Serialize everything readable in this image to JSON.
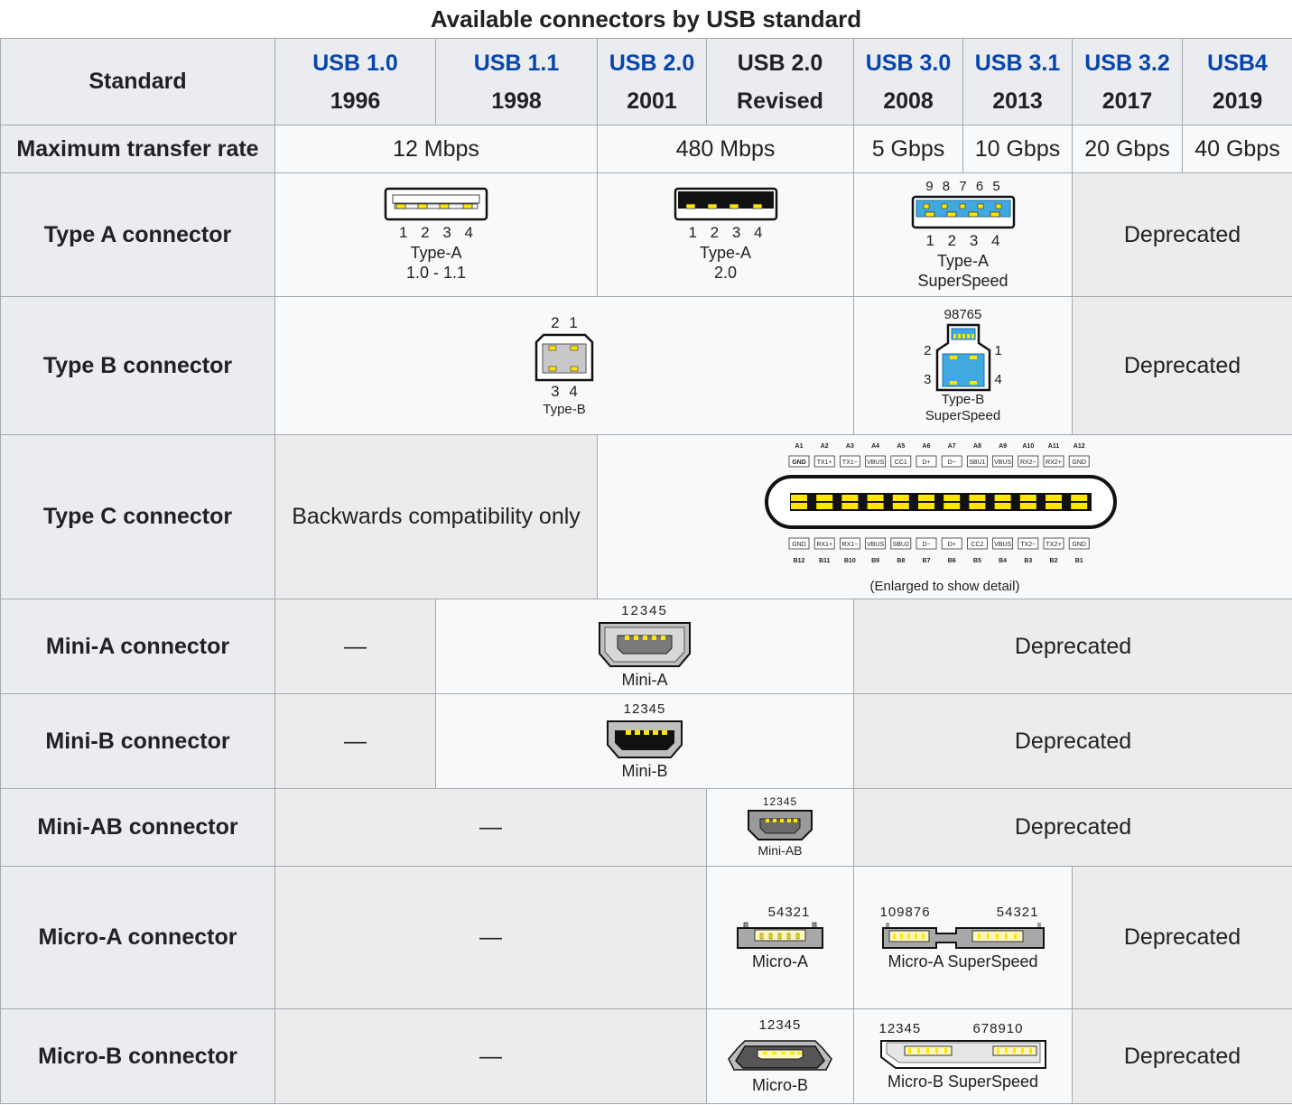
{
  "caption": "Available connectors by USB standard",
  "header": {
    "standard_label": "Standard",
    "columns": [
      {
        "name": "USB 1.0",
        "year": "1996",
        "link": true
      },
      {
        "name": "USB 1.1",
        "year": "1998",
        "link": true
      },
      {
        "name": "USB 2.0",
        "year": "2001",
        "link": true
      },
      {
        "name": "USB 2.0",
        "year": "Revised",
        "link": false
      },
      {
        "name": "USB 3.0",
        "year": "2008",
        "link": true
      },
      {
        "name": "USB 3.1",
        "year": "2013",
        "link": true
      },
      {
        "name": "USB 3.2",
        "year": "2017",
        "link": true
      },
      {
        "name": "USB4",
        "year": "2019",
        "link": true
      }
    ]
  },
  "rows": {
    "rate": {
      "label": "Maximum transfer rate",
      "v1": "12 Mbps",
      "v2": "480 Mbps",
      "v3": "5 Gbps",
      "v4": "10 Gbps",
      "v5": "20 Gbps",
      "v6": "40 Gbps"
    },
    "type_a": {
      "label": "Type A connector",
      "img1": {
        "pins": "1 2 3 4",
        "cap1": "Type-A",
        "cap2": "1.0 - 1.1"
      },
      "img2": {
        "pins": "1 2 3 4",
        "cap1": "Type-A",
        "cap2": "2.0"
      },
      "img3": {
        "top_pins": "9 8 7 6 5",
        "pins": "1 2 3 4",
        "cap1": "Type-A",
        "cap2": "SuperSpeed"
      },
      "deprecated": "Deprecated"
    },
    "type_b": {
      "label": "Type B connector",
      "img1": {
        "top": "2 1",
        "bottom": "3 4",
        "cap": "Type-B"
      },
      "img2": {
        "top": "98765",
        "l2": "2",
        "r1": "1",
        "l3": "3",
        "r4": "4",
        "cap1": "Type-B",
        "cap2": "SuperSpeed"
      },
      "deprecated": "Deprecated"
    },
    "type_c": {
      "label": "Type C connector",
      "backwards": "Backwards compatibility only",
      "top_ids": [
        "A1",
        "A2",
        "A3",
        "A4",
        "A5",
        "A6",
        "A7",
        "A8",
        "A9",
        "A10",
        "A11",
        "A12"
      ],
      "top_names": [
        "GND",
        "TX1+",
        "TX1−",
        "VBUS",
        "CC1",
        "D+",
        "D−",
        "SBU1",
        "VBUS",
        "RX2−",
        "RX2+",
        "GND"
      ],
      "bottom_names": [
        "GND",
        "RX1+",
        "RX1−",
        "VBUS",
        "SBU2",
        "D−",
        "D+",
        "CC2",
        "VBUS",
        "TX2−",
        "TX2+",
        "GND"
      ],
      "bottom_ids": [
        "B12",
        "B11",
        "B10",
        "B9",
        "B8",
        "B7",
        "B6",
        "B5",
        "B4",
        "B3",
        "B2",
        "B1"
      ],
      "note": "(Enlarged to show detail)"
    },
    "mini_a": {
      "label": "Mini-A connector",
      "dash": "—",
      "pins": "12345",
      "cap": "Mini-A",
      "deprecated": "Deprecated"
    },
    "mini_b": {
      "label": "Mini-B connector",
      "dash": "—",
      "pins": "12345",
      "cap": "Mini-B",
      "deprecated": "Deprecated"
    },
    "mini_ab": {
      "label": "Mini-AB connector",
      "dash": "—",
      "pins": "12345",
      "cap": "Mini-AB",
      "deprecated": "Deprecated"
    },
    "micro_a": {
      "label": "Micro-A connector",
      "dash": "—",
      "pins": "54321",
      "cap": "Micro-A",
      "ss_left": "109876",
      "ss_right": "54321",
      "ss_cap": "Micro-A SuperSpeed",
      "deprecated": "Deprecated"
    },
    "micro_b": {
      "label": "Micro-B connector",
      "dash": "—",
      "pins": "12345",
      "cap": "Micro-B",
      "ss_left": "12345",
      "ss_right": "678910",
      "ss_cap": "Micro-B SuperSpeed",
      "deprecated": "Deprecated"
    }
  },
  "colors": {
    "link": "#0645ad",
    "header_bg": "#eaecf0",
    "deprecated_bg": "#ececec",
    "superspeed_blue": "#3fa9e0",
    "pin_yellow": "#ffe600"
  }
}
